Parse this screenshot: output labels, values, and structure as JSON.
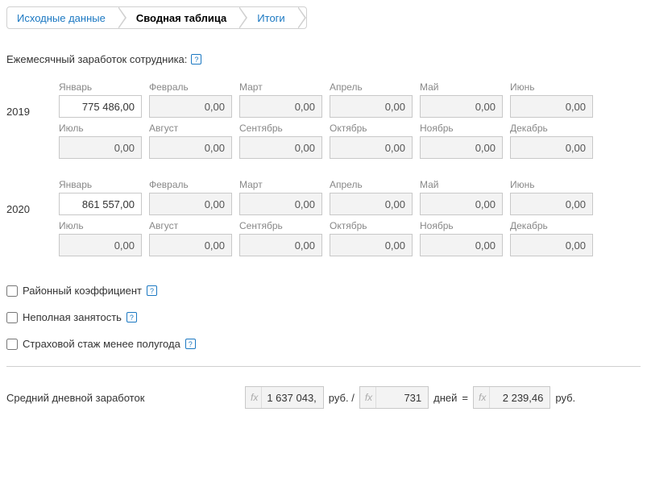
{
  "tabs": {
    "source": "Исходные данные",
    "summary": "Сводная таблица",
    "totals": "Итоги"
  },
  "section_label": "Ежемесячный заработок сотрудника:",
  "years": [
    {
      "year": "2019",
      "months": [
        {
          "label": "Январь",
          "value": "775 486,00",
          "filled": true
        },
        {
          "label": "Февраль",
          "value": "0,00"
        },
        {
          "label": "Март",
          "value": "0,00"
        },
        {
          "label": "Апрель",
          "value": "0,00"
        },
        {
          "label": "Май",
          "value": "0,00"
        },
        {
          "label": "Июнь",
          "value": "0,00"
        },
        {
          "label": "Июль",
          "value": "0,00"
        },
        {
          "label": "Август",
          "value": "0,00"
        },
        {
          "label": "Сентябрь",
          "value": "0,00"
        },
        {
          "label": "Октябрь",
          "value": "0,00"
        },
        {
          "label": "Ноябрь",
          "value": "0,00"
        },
        {
          "label": "Декабрь",
          "value": "0,00"
        }
      ]
    },
    {
      "year": "2020",
      "months": [
        {
          "label": "Январь",
          "value": "861 557,00",
          "filled": true
        },
        {
          "label": "Февраль",
          "value": "0,00"
        },
        {
          "label": "Март",
          "value": "0,00"
        },
        {
          "label": "Апрель",
          "value": "0,00"
        },
        {
          "label": "Май",
          "value": "0,00"
        },
        {
          "label": "Июнь",
          "value": "0,00"
        },
        {
          "label": "Июль",
          "value": "0,00"
        },
        {
          "label": "Август",
          "value": "0,00"
        },
        {
          "label": "Сентябрь",
          "value": "0,00"
        },
        {
          "label": "Октябрь",
          "value": "0,00"
        },
        {
          "label": "Ноябрь",
          "value": "0,00"
        },
        {
          "label": "Декабрь",
          "value": "0,00"
        }
      ]
    }
  ],
  "options": {
    "district_coef": "Районный коэффициент",
    "part_time": "Неполная занятость",
    "insurance": "Страховой стаж менее полугода"
  },
  "result": {
    "label": "Средний дневной заработок",
    "sum": "1 637 043,",
    "sum_unit": "руб. /",
    "days": "731",
    "days_unit": "дней",
    "equals": "=",
    "daily": "2 239,46",
    "daily_unit": "руб."
  },
  "fx": "fx",
  "help": "?"
}
